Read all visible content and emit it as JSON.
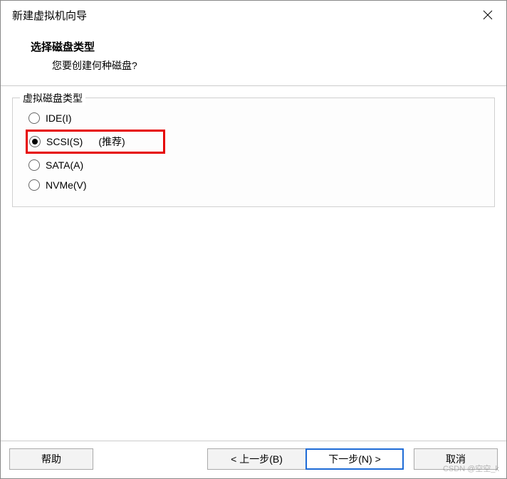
{
  "window": {
    "title": "新建虚拟机向导"
  },
  "header": {
    "title": "选择磁盘类型",
    "subtitle": "您要创建何种磁盘?"
  },
  "group": {
    "legend": "虚拟磁盘类型",
    "options": [
      {
        "label": "IDE(I)",
        "checked": false,
        "hint": ""
      },
      {
        "label": "SCSI(S)",
        "checked": true,
        "hint": "(推荐)"
      },
      {
        "label": "SATA(A)",
        "checked": false,
        "hint": ""
      },
      {
        "label": "NVMe(V)",
        "checked": false,
        "hint": ""
      }
    ]
  },
  "buttons": {
    "help": "帮助",
    "back": "< 上一步(B)",
    "next": "下一步(N) >",
    "cancel": "取消"
  },
  "watermark": "CSDN @空空_k"
}
